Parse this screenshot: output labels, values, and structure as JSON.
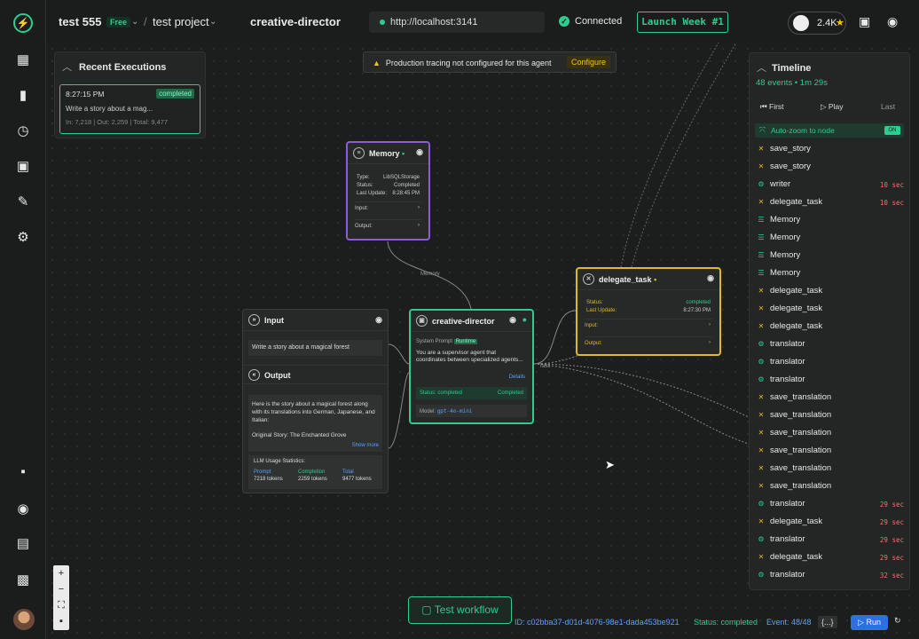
{
  "topbar": {
    "project_team": "test 555",
    "plan_badge": "Free",
    "project_name": "test project",
    "agent_title": "creative-director",
    "url": "http://localhost:3141",
    "connection": "Connected",
    "launch": "Launch Week #1",
    "github_stars": "2.4K"
  },
  "recent": {
    "title": "Recent Executions",
    "time": "8:27:15 PM",
    "badge": "completed",
    "task": "Write a story about a mag...",
    "tokens": "In: 7,218 | Out: 2,259 | Total: 9,477"
  },
  "banner": {
    "text": "Production tracing not configured for this agent",
    "button": "Configure"
  },
  "memory_node": {
    "title": "Memory",
    "type_label": "Type:",
    "type_value": "LibSQLStorage",
    "status_label": "Status:",
    "status_value": "Completed",
    "update_label": "Last Update:",
    "update_value": "8:28:45 PM",
    "input": "Input:",
    "output": "Output:"
  },
  "delegate_node": {
    "title": "delegate_task",
    "status_label": "Status:",
    "status_value": "completed",
    "update_label": "Last Update:",
    "update_value": "8:27:30 PM",
    "input": "Input:",
    "output": "Output:"
  },
  "cd_node": {
    "title": "creative-director",
    "prompt_label": "System Prompt",
    "prompt_badge": "Runtime",
    "prompt_text": "You are a supervisor agent that coordinates between specialized agents...",
    "details": "Details",
    "status_label": "Status: completed",
    "status_value": "Completed",
    "model_label": "Model:",
    "model_value": "gpt-4o-mini"
  },
  "io_node": {
    "input_title": "Input",
    "input_text": "Write a story about a magical forest",
    "output_title": "Output",
    "output_text": "Here is the story about a magical forest along with its translations into German, Japanese, and Italian:",
    "output_story": "Original Story: The Enchanted Grove",
    "show_more": "Show more",
    "llm_title": "LLM Usage Statistics:",
    "prompt_label": "Prompt",
    "prompt_value": "7218 tokens",
    "completion_label": "Completion",
    "completion_value": "2259 tokens",
    "total_label": "Total",
    "total_value": "9477 tokens"
  },
  "wire_labels": {
    "memory": "Memory",
    "task": "Task"
  },
  "timeline": {
    "title": "Timeline",
    "subtitle": "48 events • 1m 29s",
    "first": "First",
    "play": "Play",
    "last": "Last",
    "autozoom": "Auto-zoom to node",
    "toggle": "ON",
    "events": [
      {
        "name": "save_story",
        "icon": "tool-icon",
        "time": ""
      },
      {
        "name": "save_story",
        "icon": "tool-icon",
        "time": ""
      },
      {
        "name": "writer",
        "icon": "agent-icon",
        "time": "10 sec"
      },
      {
        "name": "delegate_task",
        "icon": "tool-icon",
        "time": "10 sec"
      },
      {
        "name": "Memory",
        "icon": "memory-icon",
        "time": ""
      },
      {
        "name": "Memory",
        "icon": "memory-icon",
        "time": ""
      },
      {
        "name": "Memory",
        "icon": "memory-icon",
        "time": ""
      },
      {
        "name": "Memory",
        "icon": "memory-icon",
        "time": ""
      },
      {
        "name": "delegate_task",
        "icon": "tool-icon",
        "time": ""
      },
      {
        "name": "delegate_task",
        "icon": "tool-icon",
        "time": ""
      },
      {
        "name": "delegate_task",
        "icon": "tool-icon",
        "time": ""
      },
      {
        "name": "translator",
        "icon": "agent-icon",
        "time": ""
      },
      {
        "name": "translator",
        "icon": "agent-icon",
        "time": ""
      },
      {
        "name": "translator",
        "icon": "agent-icon",
        "time": ""
      },
      {
        "name": "save_translation",
        "icon": "tool-icon",
        "time": ""
      },
      {
        "name": "save_translation",
        "icon": "tool-icon",
        "time": ""
      },
      {
        "name": "save_translation",
        "icon": "tool-icon",
        "time": ""
      },
      {
        "name": "save_translation",
        "icon": "tool-icon",
        "time": ""
      },
      {
        "name": "save_translation",
        "icon": "tool-icon",
        "time": ""
      },
      {
        "name": "save_translation",
        "icon": "tool-icon",
        "time": ""
      },
      {
        "name": "translator",
        "icon": "agent-icon",
        "time": "29 sec"
      },
      {
        "name": "delegate_task",
        "icon": "tool-icon",
        "time": "29 sec"
      },
      {
        "name": "translator",
        "icon": "agent-icon",
        "time": "29 sec"
      },
      {
        "name": "delegate_task",
        "icon": "tool-icon",
        "time": "29 sec"
      },
      {
        "name": "translator",
        "icon": "agent-icon",
        "time": "32 sec"
      }
    ]
  },
  "bottom": {
    "test_workflow": "Test workflow",
    "trace_id": "ID: c02bba37-d01d-4076-98e1-dada453be921",
    "status": "Status: completed",
    "event": "Event: 48/48",
    "json_button": "{...}",
    "run": "Run"
  },
  "colors": {
    "accent": "#2ecc8f",
    "memory": "#8e5bd8",
    "tool": "#e0b82a",
    "run": "#2f6fe4"
  }
}
